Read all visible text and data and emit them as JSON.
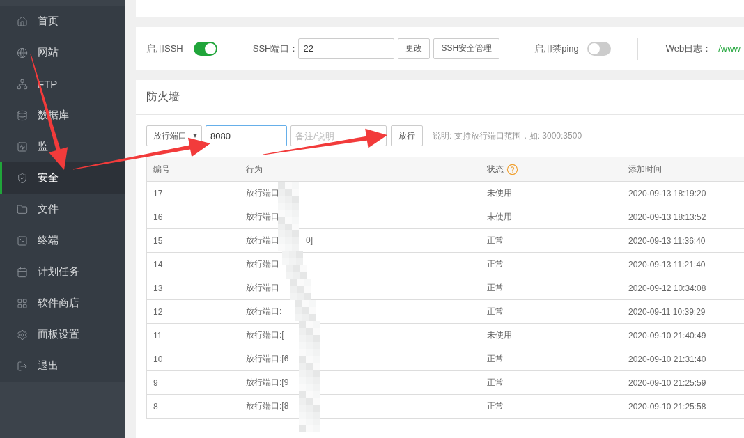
{
  "sidebar": {
    "items": [
      {
        "label": "首页",
        "selected": false
      },
      {
        "label": "网站",
        "selected": false
      },
      {
        "label": "FTP",
        "selected": false
      },
      {
        "label": "数据库",
        "selected": false
      },
      {
        "label": "监",
        "selected": false
      },
      {
        "label": "安全",
        "selected": true
      },
      {
        "label": "文件",
        "selected": false
      },
      {
        "label": "终端",
        "selected": false
      },
      {
        "label": "计划任务",
        "selected": false
      },
      {
        "label": "软件商店",
        "selected": false
      },
      {
        "label": "面板设置",
        "selected": false
      },
      {
        "label": "退出",
        "selected": false
      }
    ]
  },
  "ssh": {
    "label": "启用SSH",
    "on": true,
    "port_label": "SSH端口：",
    "port": "22",
    "change_button": "更改",
    "manage_button": "SSH安全管理",
    "ping_label": "启用禁ping",
    "ping_on": false,
    "web_log_label": "Web日志：",
    "web_log_path": "/www"
  },
  "firewall": {
    "title": "防火墙",
    "type_select": "放行端口",
    "port_value": "8080",
    "note_placeholder": "备注/说明",
    "submit_button": "放行",
    "hint": "说明: 支持放行端口范围，如: 3000:3500",
    "columns": [
      "编号",
      "行为",
      "状态",
      "添加时间"
    ],
    "rows": [
      {
        "id": "17",
        "action": "放行端口",
        "status": "未使用",
        "time": "2020-09-13 18:19:20"
      },
      {
        "id": "16",
        "action": "放行端口",
        "status": "未使用",
        "time": "2020-09-13 18:13:52"
      },
      {
        "id": "15",
        "action": "放行端口",
        "action_tail": "0]",
        "status": "正常",
        "time": "2020-09-13 11:36:40"
      },
      {
        "id": "14",
        "action": "放行端口",
        "status": "正常",
        "time": "2020-09-13 11:21:40"
      },
      {
        "id": "13",
        "action": "放行端口",
        "status": "正常",
        "time": "2020-09-12 10:34:08"
      },
      {
        "id": "12",
        "action": "放行端口:",
        "status": "正常",
        "time": "2020-09-11 10:39:29"
      },
      {
        "id": "11",
        "action": "放行端口:[",
        "status": "未使用",
        "time": "2020-09-10 21:40:49"
      },
      {
        "id": "10",
        "action": "放行端口:[6",
        "status": "正常",
        "time": "2020-09-10 21:31:40"
      },
      {
        "id": "9",
        "action": "放行端口:[9",
        "status": "正常",
        "time": "2020-09-10 21:25:59"
      },
      {
        "id": "8",
        "action": "放行端口:[8",
        "status": "正常",
        "time": "2020-09-10 21:25:58"
      }
    ]
  }
}
